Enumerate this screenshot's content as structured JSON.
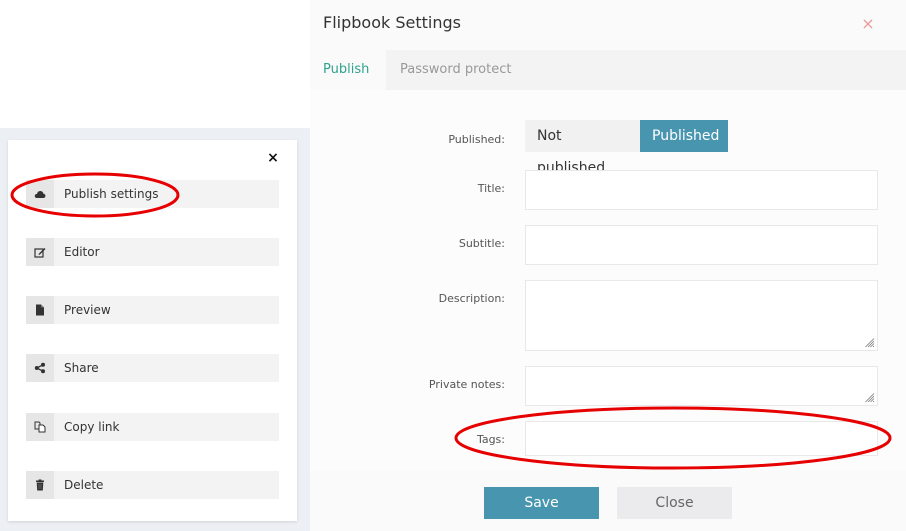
{
  "menu": {
    "close_icon": "×",
    "items": [
      {
        "label": "Publish settings",
        "icon": "cloud-icon"
      },
      {
        "label": "Editor",
        "icon": "edit-icon"
      },
      {
        "label": "Preview",
        "icon": "file-icon"
      },
      {
        "label": "Share",
        "icon": "share-icon"
      },
      {
        "label": "Copy link",
        "icon": "copy-icon"
      },
      {
        "label": "Delete",
        "icon": "trash-icon"
      }
    ]
  },
  "dialog": {
    "title": "Flipbook Settings",
    "close_icon": "×",
    "tabs": [
      {
        "label": "Publish",
        "active": true
      },
      {
        "label": "Password protect",
        "active": false
      }
    ],
    "form": {
      "published_label": "Published:",
      "published_options": [
        "Not published",
        "Published"
      ],
      "published_selected": "Published",
      "title_label": "Title:",
      "title_value": "",
      "subtitle_label": "Subtitle:",
      "subtitle_value": "",
      "description_label": "Description:",
      "description_value": "",
      "private_notes_label": "Private notes:",
      "private_notes_value": "",
      "tags_label": "Tags:",
      "tags_value": ""
    },
    "buttons": {
      "save": "Save",
      "close": "Close"
    }
  },
  "colors": {
    "accent": "#4895b0",
    "tab_active": "#2fa38d",
    "annotation": "#e60000",
    "close_x": "#e79d9d"
  }
}
